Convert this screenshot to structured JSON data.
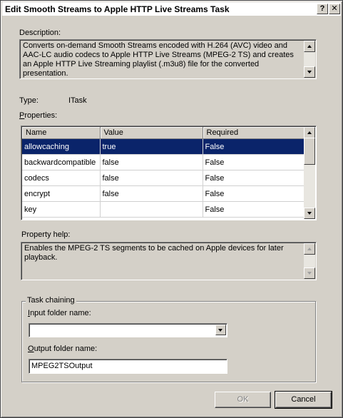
{
  "window": {
    "title": "Edit Smooth Streams to Apple HTTP Live Streams Task",
    "help_label": "?",
    "close_label": "✕"
  },
  "description": {
    "label": "Description:",
    "text": "Converts on-demand Smooth Streams encoded with H.264 (AVC) video and AAC-LC audio codecs to Apple HTTP Live Streams (MPEG-2 TS) and creates an Apple HTTP Live Streaming playlist (.m3u8) file for the converted presentation."
  },
  "type": {
    "label": "Type:",
    "value": "ITask"
  },
  "properties": {
    "label_first": "P",
    "label_rest": "roperties:",
    "columns": {
      "name": "Name",
      "value": "Value",
      "required": "Required"
    },
    "rows": [
      {
        "name": "allowcaching",
        "value": "true",
        "required": "False",
        "selected": true
      },
      {
        "name": "backwardcompatible",
        "value": "false",
        "required": "False",
        "selected": false
      },
      {
        "name": "codecs",
        "value": "false",
        "required": "False",
        "selected": false
      },
      {
        "name": "encrypt",
        "value": "false",
        "required": "False",
        "selected": false
      },
      {
        "name": "key",
        "value": "",
        "required": "False",
        "selected": false
      }
    ]
  },
  "property_help": {
    "label": "Property help:",
    "text": "Enables the MPEG-2 TS segments to be cached on Apple devices for later playback."
  },
  "task_chaining": {
    "caption": "Task chaining",
    "input_label_first": "I",
    "input_label_rest": "nput folder name:",
    "input_value": "",
    "output_label_first": "O",
    "output_label_rest": "utput folder name:",
    "output_value": "MPEG2TSOutput"
  },
  "buttons": {
    "ok": "OK",
    "cancel": "Cancel"
  }
}
